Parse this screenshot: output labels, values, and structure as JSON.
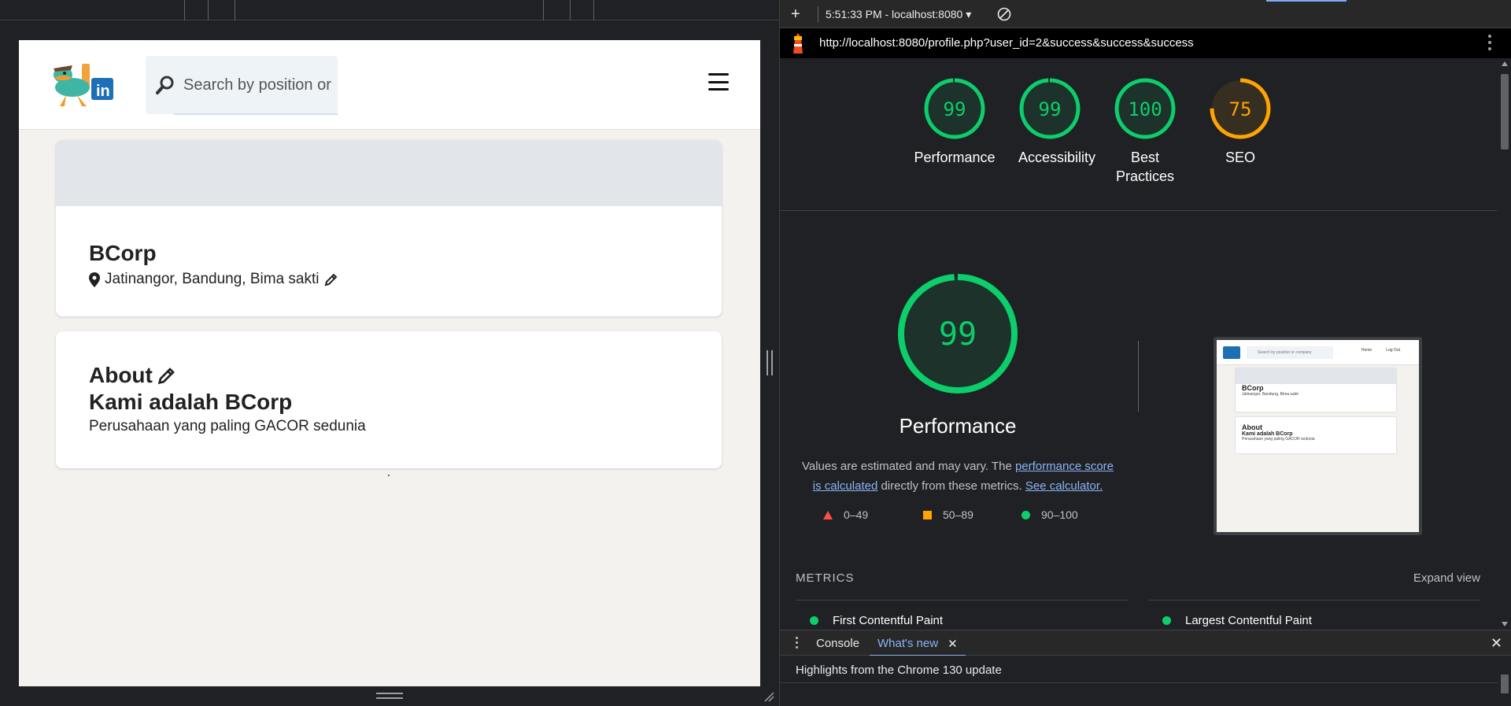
{
  "site": {
    "search_placeholder": "Search by position or",
    "profile": {
      "name": "BCorp",
      "location": "Jatinangor, Bandung, Bima sakti"
    },
    "about": {
      "heading": "About",
      "title": "Kami adalah BCorp",
      "description": "Perusahaan yang paling GACOR sedunia"
    }
  },
  "devtools": {
    "toolbar": {
      "time_host": "5:51:33 PM - localhost:8080 ▾"
    },
    "url": "http://localhost:8080/profile.php?user_id=2&success&success&success",
    "scores": [
      {
        "value": "99",
        "label": "Performance",
        "color": "#0cce6b"
      },
      {
        "value": "99",
        "label": "Accessibility",
        "color": "#0cce6b"
      },
      {
        "value": "100",
        "label": "Best Practices",
        "color": "#0cce6b"
      },
      {
        "value": "75",
        "label": "SEO",
        "color": "#ffa400"
      }
    ],
    "main_score": {
      "value": "99",
      "title": "Performance",
      "desc_prefix": "Values are estimated and may vary. The ",
      "link1": "performance score is calculated",
      "desc_mid": " directly from these metrics. ",
      "link2": "See calculator."
    },
    "legend": [
      "0–49",
      "50–89",
      "90–100"
    ],
    "thumbnail": {
      "search": "Search by position or company",
      "nav_home": "Home",
      "nav_logout": "Log Out",
      "name": "BCorp",
      "location": "Jatinangor, Bandung, Bima sakti",
      "about": "About",
      "title": "Kami adalah BCorp",
      "desc": "Perusahaan yang paling GACOR sedunia"
    },
    "metrics_heading": "METRICS",
    "expand_view": "Expand view",
    "metrics": [
      "First Contentful Paint",
      "Largest Contentful Paint"
    ],
    "drawer": {
      "tab_console": "Console",
      "tab_whats_new": "What's new",
      "highlight": "Highlights from the Chrome 130 update"
    }
  },
  "colors": {
    "pass": "#0cce6b",
    "average": "#ffa400",
    "fail": "#ff4e42",
    "link": "#8ab4f8"
  }
}
